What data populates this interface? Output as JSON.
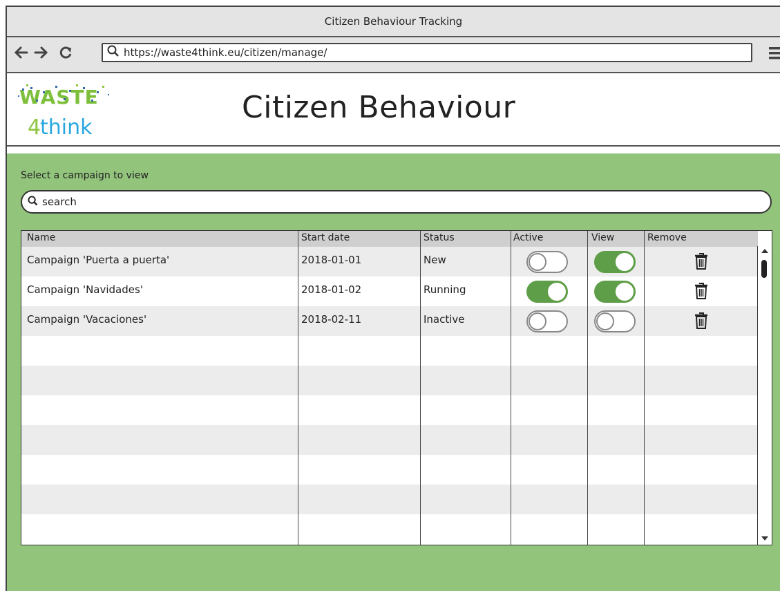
{
  "window": {
    "title": "Citizen Behaviour Tracking"
  },
  "browser": {
    "url": "https://waste4think.eu/citizen/manage/",
    "icons": [
      "back-arrow-icon",
      "forward-arrow-icon",
      "reload-icon",
      "search-icon",
      "hamburger-menu-icon"
    ]
  },
  "header": {
    "logo_top": "WASTE",
    "logo_bottom": "4think",
    "title": "Citizen Behaviour"
  },
  "colors": {
    "background": "#92c47c",
    "toggle_on": "#5f9e48",
    "header_row": "#cfcfcf",
    "alt_row": "#ececec",
    "logo_green": "#8dc63f",
    "logo_blue": "#29a8e0"
  },
  "main": {
    "prompt": "Select a campaign to view",
    "search_placeholder": "search",
    "columns": [
      "Name",
      "Start date",
      "Status",
      "Active",
      "View",
      "Remove"
    ],
    "rows": [
      {
        "name": "Campaign 'Puerta a puerta'",
        "start_date": "2018-01-01",
        "status": "New",
        "active": false,
        "view": true
      },
      {
        "name": "Campaign 'Navidades'",
        "start_date": "2018-01-02",
        "status": "Running",
        "active": true,
        "view": true
      },
      {
        "name": "Campaign 'Vacaciones'",
        "start_date": "2018-02-11",
        "status": "Inactive",
        "active": false,
        "view": false
      }
    ]
  }
}
